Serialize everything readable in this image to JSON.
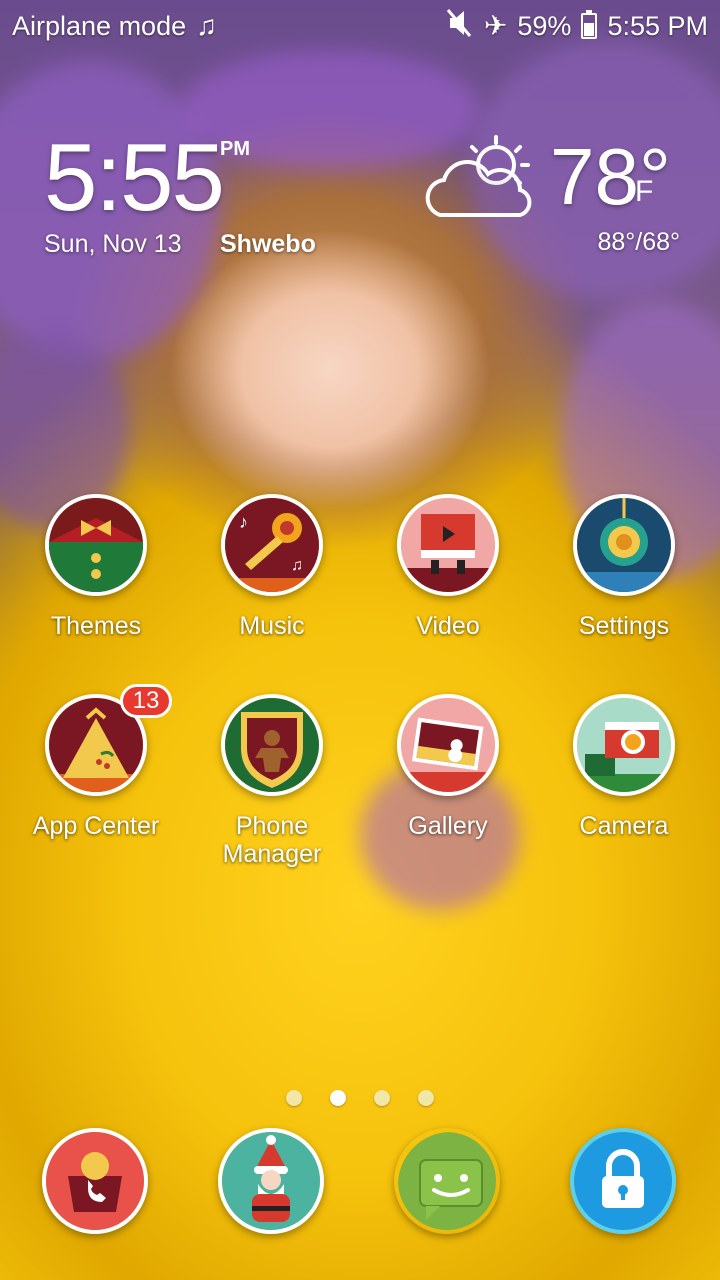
{
  "status_bar": {
    "left_text": "Airplane mode",
    "music_icon": "music-note-icon",
    "battery_percent": "59%",
    "battery_level": 0.59,
    "time": "5:55 PM"
  },
  "clock": {
    "time": "5:55",
    "ampm": "PM",
    "date": "Sun, Nov 13",
    "city": "Shwebo"
  },
  "weather": {
    "temp": "78°",
    "unit": "F",
    "hilo": "88°/68°",
    "icon": "partly-cloudy-icon"
  },
  "apps": [
    {
      "label": "Themes"
    },
    {
      "label": "Music"
    },
    {
      "label": "Video"
    },
    {
      "label": "Settings"
    },
    {
      "label": "App Center",
      "badge": "13"
    },
    {
      "label": "Phone\nManager"
    },
    {
      "label": "Gallery"
    },
    {
      "label": "Camera"
    }
  ],
  "dock": [
    "phone-icon",
    "contacts-santa-icon",
    "messaging-icon",
    "lock-icon"
  ],
  "pages": {
    "count": 4,
    "active": 1
  }
}
